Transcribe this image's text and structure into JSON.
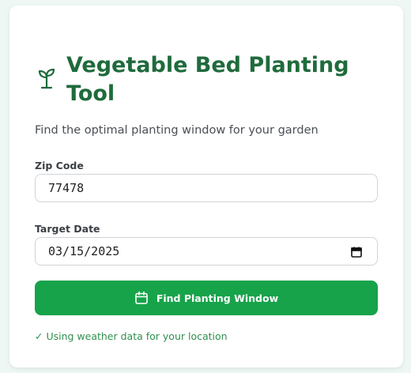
{
  "app": {
    "title": "Vegetable Bed Planting Tool",
    "subtitle": "Find the optimal planting window for your garden"
  },
  "form": {
    "zip_label": "Zip Code",
    "zip_value": "77478",
    "date_label": "Target Date",
    "date_value": "03/15/2025",
    "submit_label": "Find Planting Window"
  },
  "status": {
    "message": "✓ Using weather data for your location"
  },
  "icons": {
    "title_icon": "sprout-icon",
    "button_icon": "calendar-icon",
    "date_picker_icon": "calendar-picker-icon"
  },
  "colors": {
    "title": "#1f6b3c",
    "button": "#17a34a",
    "status": "#2f8f4e",
    "background": "#eef7f4"
  }
}
